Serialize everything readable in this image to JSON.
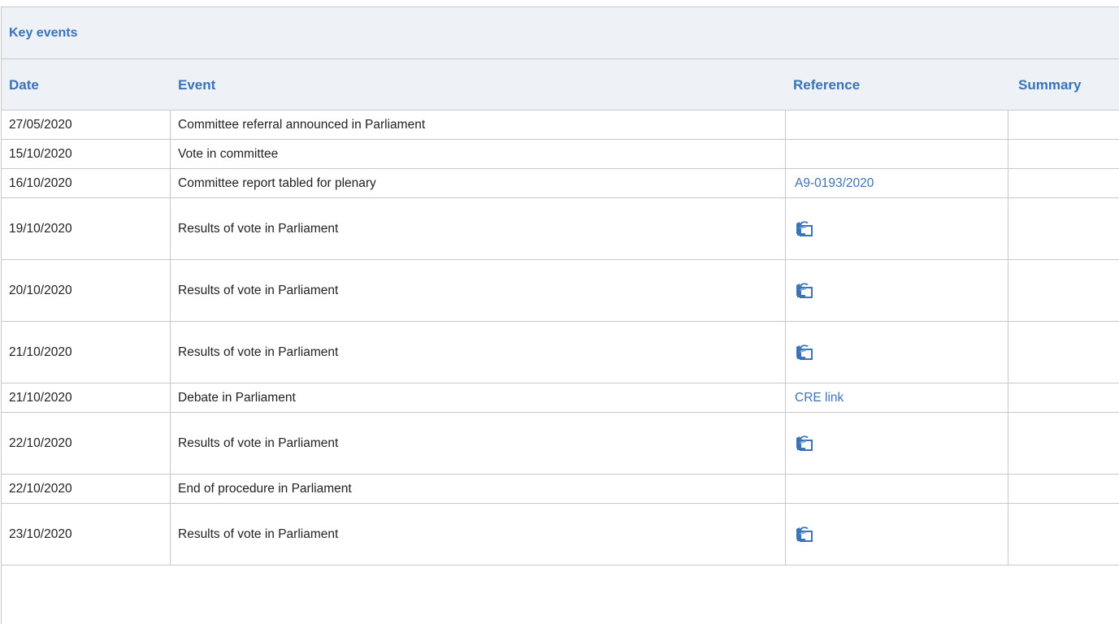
{
  "panel": {
    "title": "Key events"
  },
  "table": {
    "headers": {
      "date": "Date",
      "event": "Event",
      "reference": "Reference",
      "summary": "Summary"
    },
    "rows": [
      {
        "date": "27/05/2020",
        "event": "Committee referral announced in Parliament",
        "reference": "",
        "ref_type": "none",
        "summary": ""
      },
      {
        "date": "15/10/2020",
        "event": "Vote in committee",
        "reference": "",
        "ref_type": "none",
        "summary": ""
      },
      {
        "date": "16/10/2020",
        "event": "Committee report tabled for plenary",
        "reference": "A9-0193/2020",
        "ref_type": "link",
        "summary": ""
      },
      {
        "date": "19/10/2020",
        "event": "Results of vote in Parliament",
        "reference": "",
        "ref_type": "icon",
        "icon": "vote-results-icon",
        "summary": ""
      },
      {
        "date": "20/10/2020",
        "event": "Results of vote in Parliament",
        "reference": "",
        "ref_type": "icon",
        "icon": "vote-results-icon",
        "summary": ""
      },
      {
        "date": "21/10/2020",
        "event": "Results of vote in Parliament",
        "reference": "",
        "ref_type": "icon",
        "icon": "vote-results-icon",
        "summary": ""
      },
      {
        "date": "21/10/2020",
        "event": "Debate in Parliament",
        "reference": "CRE link",
        "ref_type": "link",
        "summary": ""
      },
      {
        "date": "22/10/2020",
        "event": "Results of vote in Parliament",
        "reference": "",
        "ref_type": "icon",
        "icon": "vote-results-icon",
        "summary": ""
      },
      {
        "date": "22/10/2020",
        "event": "End of procedure in Parliament",
        "reference": "",
        "ref_type": "none",
        "summary": ""
      },
      {
        "date": "23/10/2020",
        "event": "Results of vote in Parliament",
        "reference": "",
        "ref_type": "icon",
        "icon": "vote-results-icon",
        "summary": ""
      }
    ]
  },
  "colors": {
    "accent": "#3a73b7",
    "header_bg": "#eef1f5",
    "border": "#c8c8c8"
  }
}
